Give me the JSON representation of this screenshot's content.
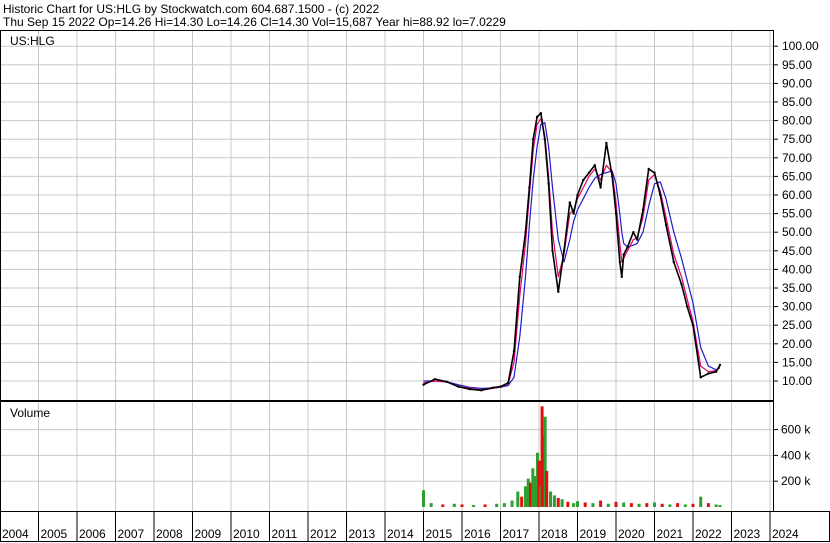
{
  "header": {
    "line1": "Historic Chart for US:HLG by Stockwatch.com 604.687.1500 - (c) 2022",
    "line2": "Thu Sep 15 2022   Op=14.26   Hi=14.30   Lo=14.26   Cl=14.30   Vol=15,687   Year hi=88.92   lo=7.0229"
  },
  "colors": {
    "grid": "#c8c8c8",
    "price": "#000000",
    "ma_short": "#e0006e",
    "ma_long": "#1c1ccc",
    "vol_up": "#2ca02c",
    "vol_down": "#e01010"
  },
  "chart_data": [
    {
      "type": "line",
      "title": "US:HLG",
      "ylim": [
        0,
        102
      ],
      "yticks": [
        "100.00",
        "95.00",
        "90.00",
        "85.00",
        "80.00",
        "75.00",
        "70.00",
        "65.00",
        "60.00",
        "55.00",
        "50.00",
        "45.00",
        "40.00",
        "35.00",
        "30.00",
        "25.00",
        "20.00",
        "15.00",
        "10.00"
      ],
      "x_labels": [
        "2004",
        "2005",
        "2006",
        "2007",
        "2008",
        "2009",
        "2010",
        "2011",
        "2012",
        "2013",
        "2014",
        "2015",
        "2016",
        "2017",
        "2018",
        "2019",
        "2020",
        "2021",
        "2022",
        "2023",
        "2024"
      ],
      "grid": true,
      "x": [
        2015.0,
        2015.3,
        2015.6,
        2015.9,
        2016.2,
        2016.5,
        2016.8,
        2017.0,
        2017.2,
        2017.35,
        2017.5,
        2017.65,
        2017.75,
        2017.85,
        2017.95,
        2018.05,
        2018.15,
        2018.25,
        2018.35,
        2018.5,
        2018.65,
        2018.8,
        2018.9,
        2019.0,
        2019.15,
        2019.3,
        2019.45,
        2019.6,
        2019.75,
        2019.9,
        2020.0,
        2020.1,
        2020.15,
        2020.2,
        2020.3,
        2020.45,
        2020.55,
        2020.7,
        2020.85,
        2021.0,
        2021.15,
        2021.3,
        2021.5,
        2021.7,
        2021.85,
        2022.0,
        2022.2,
        2022.4,
        2022.6,
        2022.7
      ],
      "series": [
        {
          "values": [
            9.0,
            10.5,
            9.8,
            8.5,
            7.8,
            7.5,
            8.2,
            8.5,
            9.5,
            18.0,
            38.0,
            50.0,
            62.0,
            75.0,
            81.0,
            82.0,
            75.0,
            63.0,
            45.0,
            34.0,
            45.0,
            58.0,
            55.0,
            60.0,
            64.0,
            66.0,
            68.0,
            62.0,
            74.0,
            65.0,
            55.0,
            42.0,
            38.0,
            44.0,
            46.0,
            50.0,
            48.0,
            56.0,
            67.0,
            66.0,
            60.0,
            52.0,
            42.0,
            36.0,
            30.0,
            25.0,
            11.0,
            12.0,
            12.5,
            14.3
          ]
        },
        {
          "values": [
            9.5,
            10.0,
            9.7,
            8.6,
            8.0,
            7.6,
            8.0,
            8.4,
            9.2,
            15.0,
            33.0,
            47.0,
            60.0,
            72.0,
            79.0,
            80.5,
            76.0,
            65.0,
            50.0,
            38.0,
            44.0,
            55.0,
            56.0,
            59.0,
            62.0,
            65.0,
            67.0,
            64.0,
            68.0,
            66.0,
            58.0,
            47.0,
            42.0,
            43.0,
            45.0,
            48.0,
            48.5,
            54.0,
            64.0,
            65.5,
            61.0,
            54.0,
            44.0,
            38.0,
            32.0,
            26.0,
            14.0,
            12.5,
            12.8,
            13.8
          ]
        },
        {
          "values": [
            10.0,
            10.0,
            9.8,
            9.0,
            8.3,
            8.0,
            8.1,
            8.3,
            8.8,
            11.0,
            22.0,
            38.0,
            52.0,
            64.0,
            73.0,
            79.0,
            79.5,
            73.0,
            62.0,
            48.0,
            42.0,
            48.0,
            53.0,
            56.0,
            59.0,
            62.0,
            64.5,
            65.5,
            66.0,
            66.5,
            63.0,
            55.0,
            50.0,
            47.0,
            46.0,
            46.5,
            47.0,
            50.0,
            57.0,
            63.0,
            63.5,
            59.0,
            50.0,
            43.0,
            37.0,
            31.0,
            19.0,
            14.0,
            13.0,
            13.5
          ]
        }
      ]
    },
    {
      "type": "bar",
      "title": "Volume",
      "ylim": [
        0,
        850000
      ],
      "yticks": [
        "600 k",
        "400 k",
        "200 k"
      ],
      "x": [
        2015.0,
        2015.2,
        2015.5,
        2015.8,
        2016.0,
        2016.3,
        2016.6,
        2016.9,
        2017.1,
        2017.3,
        2017.45,
        2017.55,
        2017.65,
        2017.72,
        2017.78,
        2017.84,
        2017.9,
        2017.96,
        2018.0,
        2018.04,
        2018.08,
        2018.12,
        2018.16,
        2018.2,
        2018.3,
        2018.4,
        2018.5,
        2018.6,
        2018.75,
        2018.9,
        2019.0,
        2019.2,
        2019.4,
        2019.6,
        2019.8,
        2020.0,
        2020.2,
        2020.4,
        2020.6,
        2020.8,
        2021.0,
        2021.2,
        2021.4,
        2021.6,
        2021.8,
        2022.0,
        2022.2,
        2022.4,
        2022.6,
        2022.7
      ],
      "values": [
        130000,
        30000,
        20000,
        25000,
        20000,
        15000,
        20000,
        25000,
        30000,
        50000,
        120000,
        80000,
        160000,
        220000,
        190000,
        300000,
        240000,
        420000,
        360000,
        160000,
        780000,
        560000,
        700000,
        280000,
        120000,
        90000,
        70000,
        60000,
        40000,
        30000,
        45000,
        35000,
        30000,
        50000,
        25000,
        40000,
        35000,
        30000,
        25000,
        30000,
        35000,
        25000,
        20000,
        30000,
        20000,
        25000,
        80000,
        30000,
        20000,
        15687
      ],
      "up": [
        true,
        true,
        false,
        true,
        false,
        true,
        false,
        true,
        true,
        true,
        true,
        false,
        true,
        true,
        false,
        true,
        true,
        true,
        false,
        true,
        false,
        false,
        true,
        false,
        true,
        true,
        false,
        true,
        false,
        true,
        true,
        false,
        true,
        false,
        true,
        false,
        true,
        false,
        true,
        false,
        true,
        false,
        true,
        false,
        true,
        false,
        true,
        false,
        true,
        true
      ]
    }
  ]
}
